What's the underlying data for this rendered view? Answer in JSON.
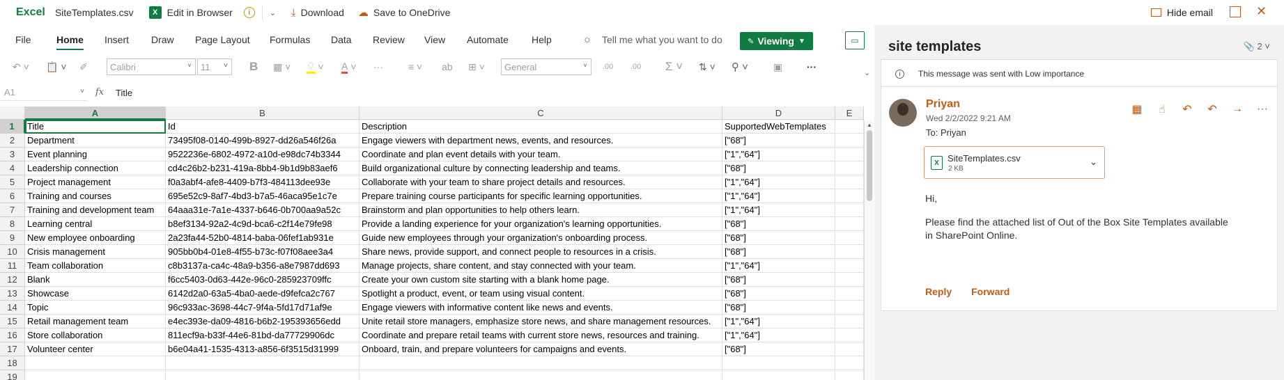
{
  "topbar": {
    "app": "Excel",
    "filename": "SiteTemplates.csv",
    "edit_label": "Edit in Browser",
    "download_label": "Download",
    "save_label": "Save to OneDrive",
    "hide_email_label": "Hide email"
  },
  "ribbon": {
    "tabs": [
      "File",
      "Home",
      "Insert",
      "Draw",
      "Page Layout",
      "Formulas",
      "Data",
      "Review",
      "View",
      "Automate",
      "Help"
    ],
    "active_tab": "Home",
    "tell_me": "Tell me what you want to do",
    "viewing_label": "Viewing",
    "font_name": "Calibri",
    "font_size": "11",
    "number_format": "General"
  },
  "formula_bar": {
    "name_box": "A1",
    "fx": "fx",
    "value": "Title"
  },
  "sheet": {
    "columns": [
      "A",
      "B",
      "C",
      "D",
      "E"
    ],
    "rows": [
      [
        "Title",
        "Id",
        "Description",
        "SupportedWebTemplates"
      ],
      [
        "Department",
        "73495f08-0140-499b-8927-dd26a546f26a",
        "Engage viewers with department news, events, and resources.",
        "[\"68\"]"
      ],
      [
        "Event planning",
        "9522236e-6802-4972-a10d-e98dc74b3344",
        "Coordinate and plan event details with your team.",
        "[\"1\",\"64\"]"
      ],
      [
        "Leadership connection",
        "cd4c26b2-b231-419a-8bb4-9b1d9b83aef6",
        "Build organizational culture by connecting leadership and teams.",
        "[\"68\"]"
      ],
      [
        "Project management",
        "f0a3abf4-afe8-4409-b7f3-484113dee93e",
        "Collaborate with your team to share project details and resources.",
        "[\"1\",\"64\"]"
      ],
      [
        "Training and courses",
        "695e52c9-8af7-4bd3-b7a5-46aca95e1c7e",
        "Prepare training course participants for specific learning opportunities.",
        "[\"1\",\"64\"]"
      ],
      [
        "Training and development team",
        "64aaa31e-7a1e-4337-b646-0b700aa9a52c",
        "Brainstorm and plan opportunities to help others learn.",
        "[\"1\",\"64\"]"
      ],
      [
        "Learning central",
        "b8ef3134-92a2-4c9d-bca6-c2f14e79fe98",
        "Provide a landing experience for your organization's learning opportunities.",
        "[\"68\"]"
      ],
      [
        "New employee onboarding",
        "2a23fa44-52b0-4814-baba-06fef1ab931e",
        "Guide new employees through your organization's onboarding process.",
        "[\"68\"]"
      ],
      [
        "Crisis management",
        "905bb0b4-01e8-4f55-b73c-f07f08aee3a4",
        "Share news, provide support, and connect people to resources in a crisis.",
        "[\"68\"]"
      ],
      [
        "Team collaboration",
        "c8b3137a-ca4c-48a9-b356-a8e7987dd693",
        "Manage projects, share content, and stay connected with your team.",
        "[\"1\",\"64\"]"
      ],
      [
        "Blank",
        "f6cc5403-0d63-442e-96c0-285923709ffc",
        "Create your own custom site starting with a blank home page.",
        "[\"68\"]"
      ],
      [
        "Showcase",
        "6142d2a0-63a5-4ba0-aede-d9fefca2c767",
        "Spotlight a product, event, or team using visual content.",
        "[\"68\"]"
      ],
      [
        "Topic",
        "96c933ac-3698-44c7-9f4a-5fd17d71af9e",
        "Engage viewers with informative content like news and events.",
        "[\"68\"]"
      ],
      [
        "Retail management team",
        "e4ec393e-da09-4816-b6b2-195393656edd",
        "Unite retail store managers, emphasize store news, and share management resources.",
        "[\"1\",\"64\"]"
      ],
      [
        "Store collaboration",
        "811ecf9a-b33f-44e6-81bd-da77729906dc",
        "Coordinate and prepare retail teams with current store news, resources and training.",
        "[\"1\",\"64\"]"
      ],
      [
        "Volunteer center",
        "b6e04a41-1535-4313-a856-6f3515d31999",
        "Onboard, train, and prepare volunteers for campaigns and events.",
        "[\"68\"]"
      ],
      [
        "",
        "",
        "",
        ""
      ],
      [
        "",
        "",
        "",
        ""
      ]
    ]
  },
  "email": {
    "subject": "site templates",
    "attachment_count": "2",
    "importance_note": "This message was sent with Low importance",
    "sender": "Priyan",
    "date": "Wed 2/2/2022 9:21 AM",
    "to": "To:  Priyan",
    "attachment_name": "SiteTemplates.csv",
    "attachment_size": "2 KB",
    "greeting": "Hi,",
    "body_line1": "Please find the attached list of Out of the Box Site Templates available",
    "body_line2": "in SharePoint Online.",
    "reply_label": "Reply",
    "forward_label": "Forward"
  },
  "colors": {
    "excel_green": "#107c41",
    "outlook_orange": "#c55a11"
  }
}
